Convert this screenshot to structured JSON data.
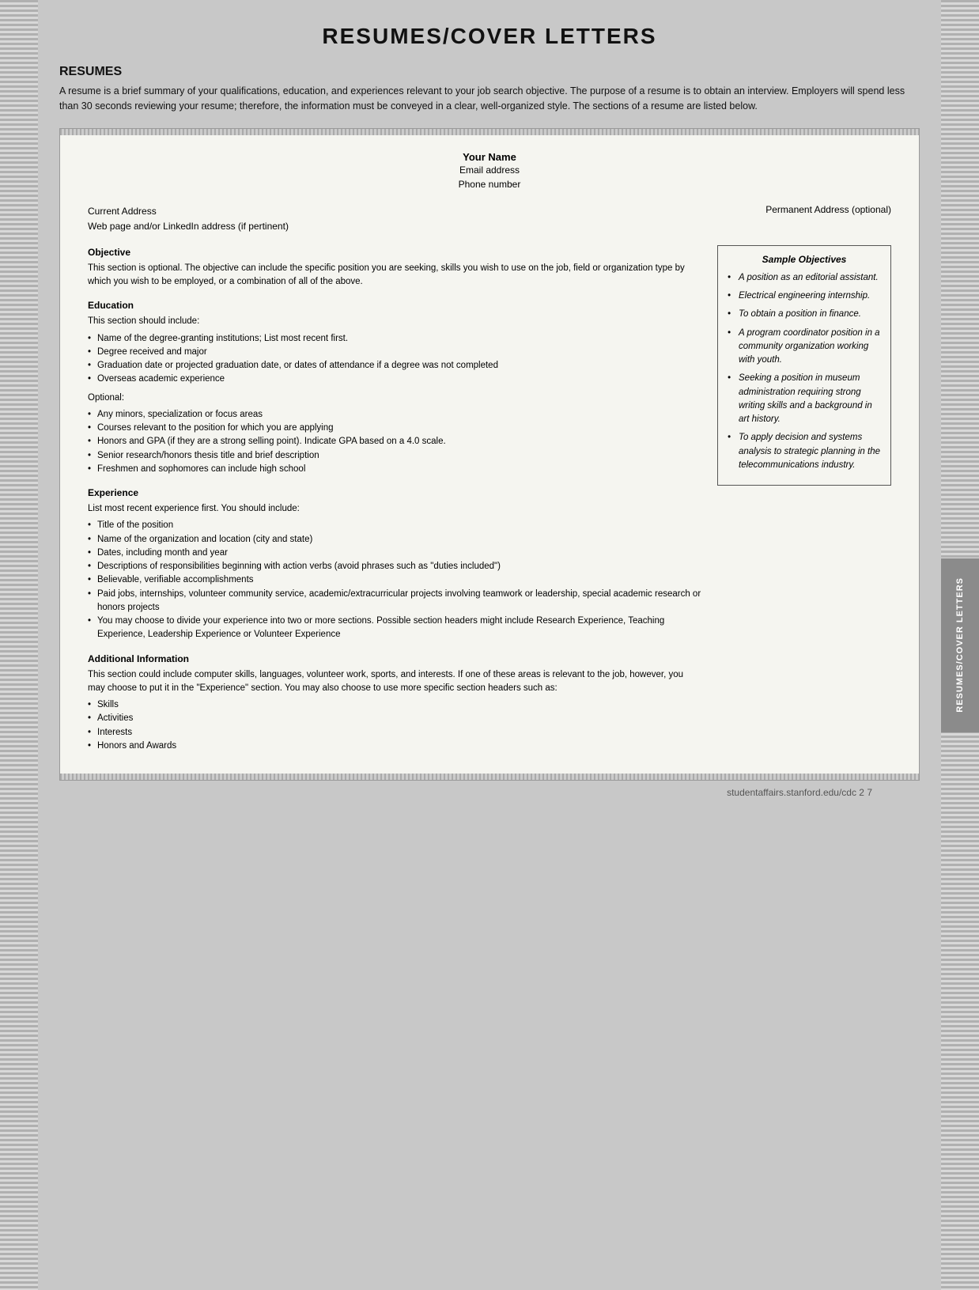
{
  "page": {
    "title": "RESUMES/COVER LETTERS",
    "footer": "studentaffairs.stanford.edu/cdc    2 7"
  },
  "resumes_section": {
    "heading": "RESUMES",
    "intro": "A resume is a brief summary of your qualifications, education, and experiences relevant to your job search objective. The purpose of a resume is to obtain an interview. Employers will spend less than 30 seconds reviewing your resume; therefore, the information must be conveyed in a clear, well-organized style. The sections of a resume are listed below."
  },
  "doc": {
    "your_name": "Your Name",
    "email": "Email address",
    "phone": "Phone number",
    "current_address": "Current Address",
    "web_address": "Web page and/or LinkedIn address (if pertinent)",
    "permanent_address": "Permanent Address (optional)",
    "sections": {
      "objective": {
        "title": "Objective",
        "text": "This section is optional. The objective can include the specific position you are seeking, skills you wish to use on the job, field or organization type by which you wish to be employed, or a combination of all of the above."
      },
      "education": {
        "title": "Education",
        "intro": "This section should include:",
        "bullets": [
          "Name of the degree-granting institutions; List most recent first.",
          "Degree received and major",
          "Graduation date or projected graduation date, or dates of attendance if a degree was not completed",
          "Overseas academic experience"
        ],
        "optional_label": "Optional:",
        "optional_bullets": [
          "Any minors, specialization or focus areas",
          "Courses relevant to the position for which you are applying",
          "Honors and GPA (if they are a strong selling point). Indicate GPA based on a 4.0 scale.",
          "Senior research/honors thesis title and brief description",
          "Freshmen and sophomores can include high school"
        ]
      },
      "experience": {
        "title": "Experience",
        "intro": "List most recent experience first. You should include:",
        "bullets": [
          "Title of the position",
          "Name of the organization and location (city and state)",
          "Dates, including month and year",
          "Descriptions of responsibilities beginning with action verbs (avoid phrases such as \"duties included\")",
          "Believable, verifiable accomplishments",
          "Paid jobs, internships, volunteer community service, academic/extracurricular projects involving teamwork or leadership, special academic research or honors projects",
          "You may choose to divide your experience into two or more sections. Possible section headers might include Research Experience, Teaching Experience, Leadership Experience or Volunteer Experience"
        ]
      },
      "additional": {
        "title": "Additional Information",
        "text": "This section could include computer skills, languages, volunteer work, sports, and interests. If one of these areas is relevant to the job, however, you may choose to put it in the \"Experience\" section. You may also choose to use more specific section headers such as:",
        "bullets": [
          "Skills",
          "Activities",
          "Interests",
          "Honors and Awards"
        ]
      }
    }
  },
  "sample_objectives": {
    "title": "Sample Objectives",
    "items": [
      "A position as an editorial assistant.",
      "Electrical engineering internship.",
      "To obtain a position in finance.",
      "A program coordinator position in a community organization working with youth.",
      "Seeking a position in museum administration requiring strong writing skills and a background in art history.",
      "To apply decision and systems analysis to strategic planning in the telecommunications industry."
    ]
  },
  "vertical_tab": {
    "text": "RESUMES/COVER LETTERS"
  }
}
